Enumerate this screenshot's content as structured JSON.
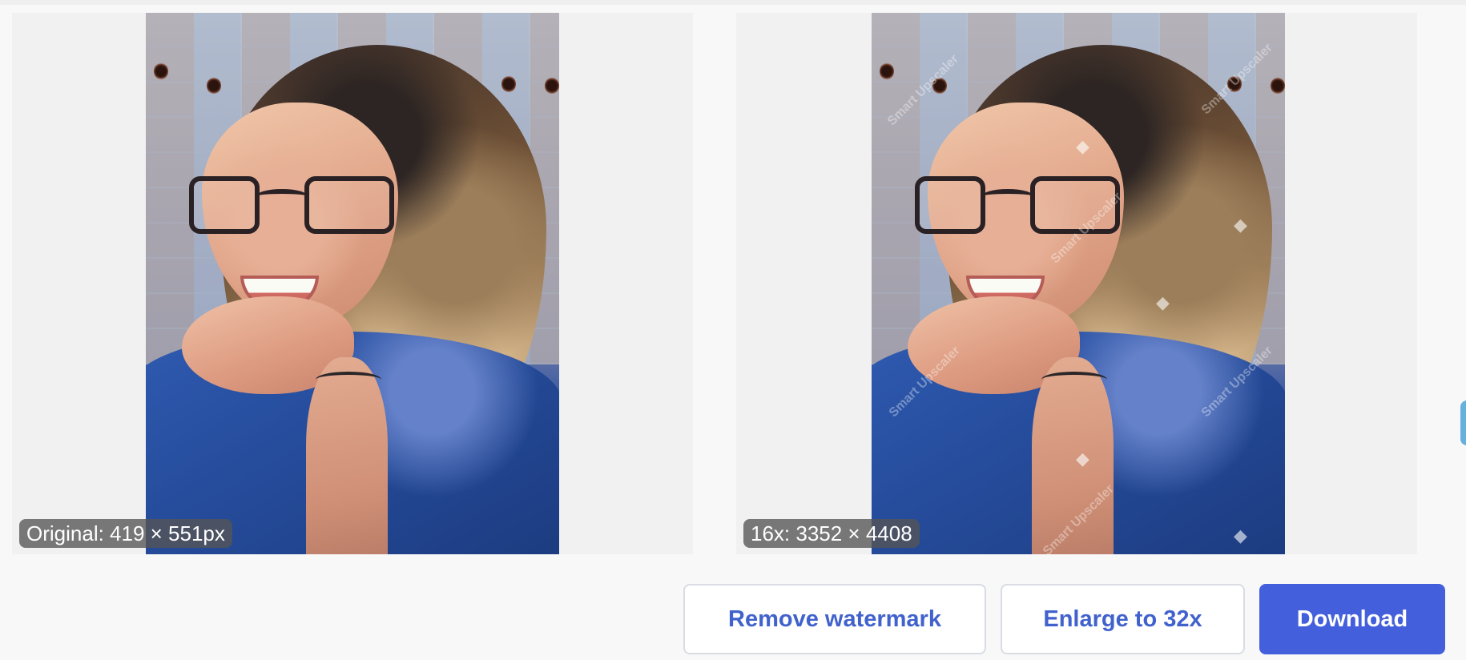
{
  "comparison": {
    "original_label": "Original: 419 × 551px",
    "upscaled_label": "16x: 3352 × 4408",
    "watermark_text": "Smart Upscaler"
  },
  "actions": {
    "remove_watermark": "Remove watermark",
    "enlarge": "Enlarge to 32x",
    "download": "Download"
  },
  "colors": {
    "primary": "#435fdc",
    "secondary_text": "#4162cd",
    "panel_background": "#f1f1f1"
  }
}
